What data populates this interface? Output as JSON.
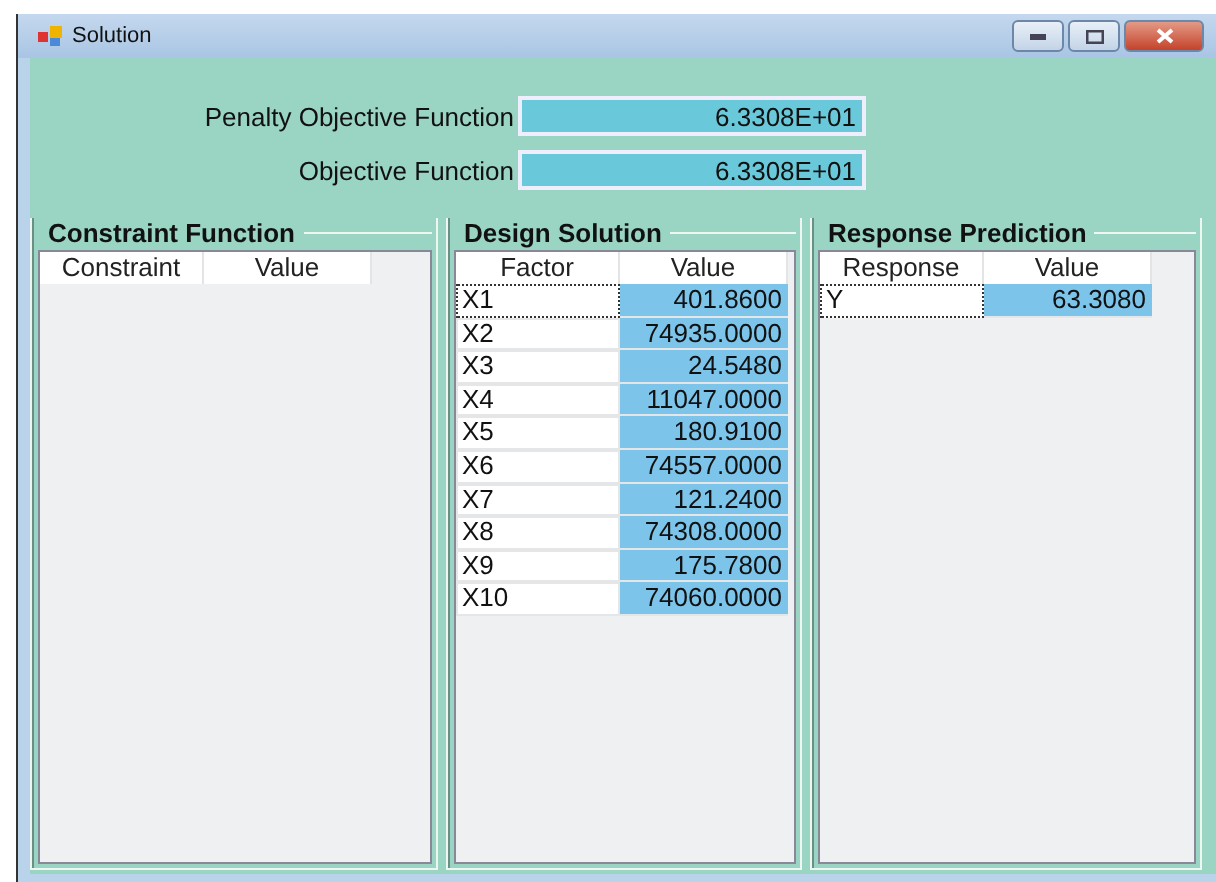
{
  "window": {
    "title": "Solution"
  },
  "fields": [
    {
      "label": "Penalty Objective Function",
      "value": "6.3308E+01"
    },
    {
      "label": "Objective Function",
      "value": "6.3308E+01"
    }
  ],
  "groups": [
    {
      "title": "Constraint Function",
      "columns": [
        "Constraint",
        "Value"
      ]
    },
    {
      "title": "Design Solution",
      "columns": [
        "Factor",
        "Value"
      ],
      "rows": [
        {
          "name": "X1",
          "value": "401.8600",
          "focused": true
        },
        {
          "name": "X2",
          "value": "74935.0000",
          "focused": false
        },
        {
          "name": "X3",
          "value": "24.5480",
          "focused": false
        },
        {
          "name": "X4",
          "value": "11047.0000",
          "focused": false
        },
        {
          "name": "X5",
          "value": "180.9100",
          "focused": false
        },
        {
          "name": "X6",
          "value": "74557.0000",
          "focused": false
        },
        {
          "name": "X7",
          "value": "121.2400",
          "focused": false
        },
        {
          "name": "X8",
          "value": "74308.0000",
          "focused": false
        },
        {
          "name": "X9",
          "value": "175.7800",
          "focused": false
        },
        {
          "name": "X10",
          "value": "74060.0000",
          "focused": false
        }
      ]
    },
    {
      "title": "Response Prediction",
      "columns": [
        "Response",
        "Value"
      ],
      "rows": [
        {
          "name": "Y",
          "value": "63.3080",
          "focused": true
        }
      ]
    }
  ]
}
